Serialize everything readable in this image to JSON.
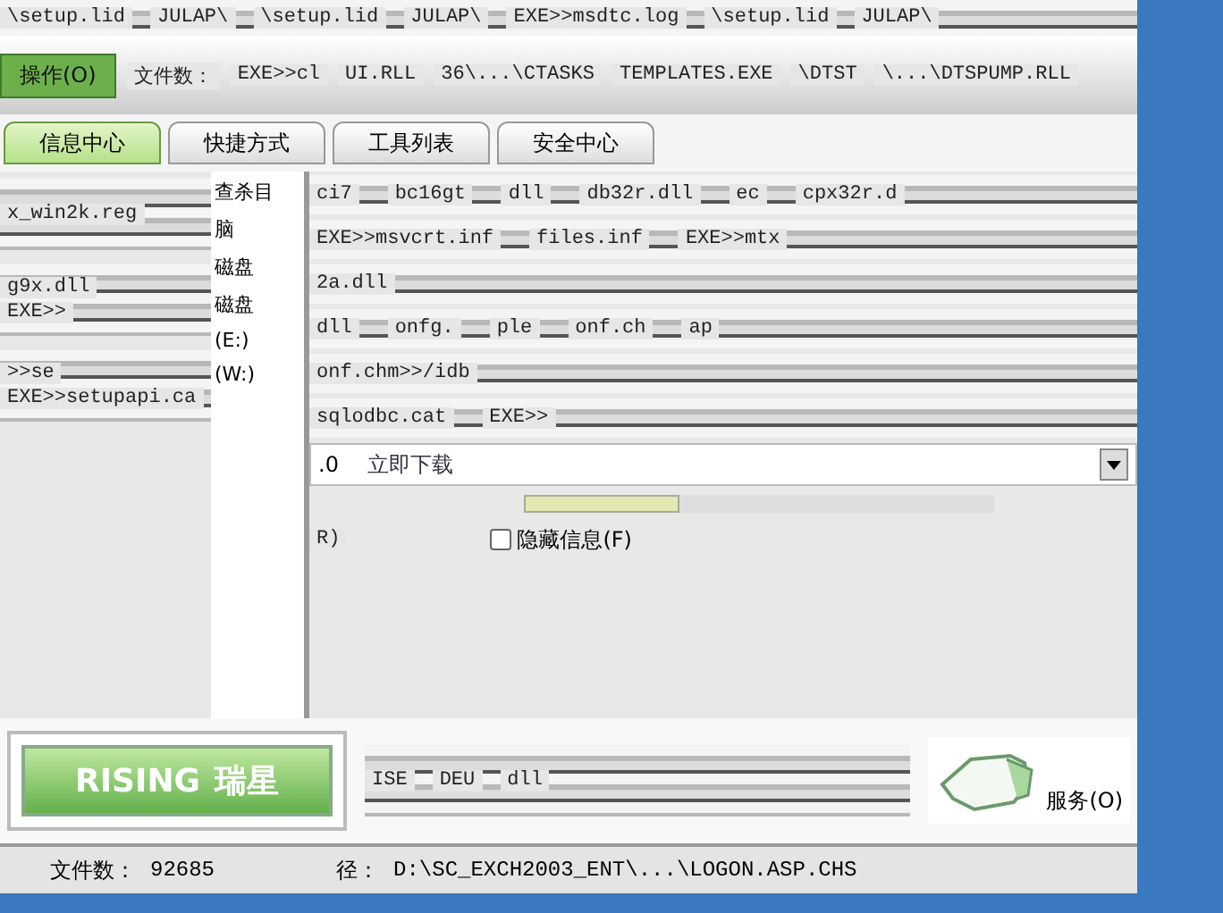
{
  "top_fragments": [
    "\\setup.lid",
    "JULAP\\",
    "\\setup.lid",
    "JULAP\\",
    "EXE>>msdtc.log",
    "\\setup.lid",
    "JULAP\\"
  ],
  "menu": {
    "button": "操作(O)",
    "label": "文件数：",
    "fragments": [
      "EXE>>cl",
      "UI.RLL",
      "36\\...\\CTASKS",
      "TEMPLATES.EXE",
      "\\DTST",
      "\\...\\DTSPUMP.RLL"
    ]
  },
  "tabs": [
    {
      "label": "信息中心",
      "selected": true
    },
    {
      "label": "快捷方式",
      "selected": false
    },
    {
      "label": "工具列表",
      "selected": false
    },
    {
      "label": "安全中心",
      "selected": false
    }
  ],
  "left_rows": [
    [
      "x_win2k.reg"
    ],
    [
      "g9x.dll",
      "EXE>>"
    ],
    [
      ">>se",
      "EXE>>setupapi.ca"
    ]
  ],
  "tree": [
    "查杀目",
    "脑",
    "磁盘",
    "磁盘",
    "(E:)",
    "(W:)"
  ],
  "right_rows": [
    [
      "ci7",
      "bc16gt",
      "dll",
      "db32r.dll",
      "ec",
      "cpx32r.d"
    ],
    [
      "EXE>>msvcrt.inf",
      "files.inf",
      "EXE>>mtx"
    ],
    [
      "2a.dll"
    ],
    [
      "dll",
      "onfg.",
      "ple",
      "onf.ch",
      "ap"
    ],
    [
      "onf.chm>>/idb"
    ],
    [
      "sqlodbc.cat",
      "EXE>>"
    ]
  ],
  "download": {
    "version": ".0",
    "link": "立即下载"
  },
  "progress": {
    "level": 0.33
  },
  "options": {
    "fragment": "R)",
    "hide_info": {
      "label": "隐藏信息(F)",
      "checked": false
    }
  },
  "logo": {
    "latin": "RISING",
    "chinese": "瑞星"
  },
  "bottom_fragments": [
    "ISE",
    "DEU",
    "dll"
  ],
  "service": "服务(O)",
  "status": {
    "count_label": "文件数：",
    "count": "92685",
    "path_label": "径：",
    "path": "D:\\SC_EXCH2003_ENT\\...\\LOGON.ASP.CHS"
  }
}
